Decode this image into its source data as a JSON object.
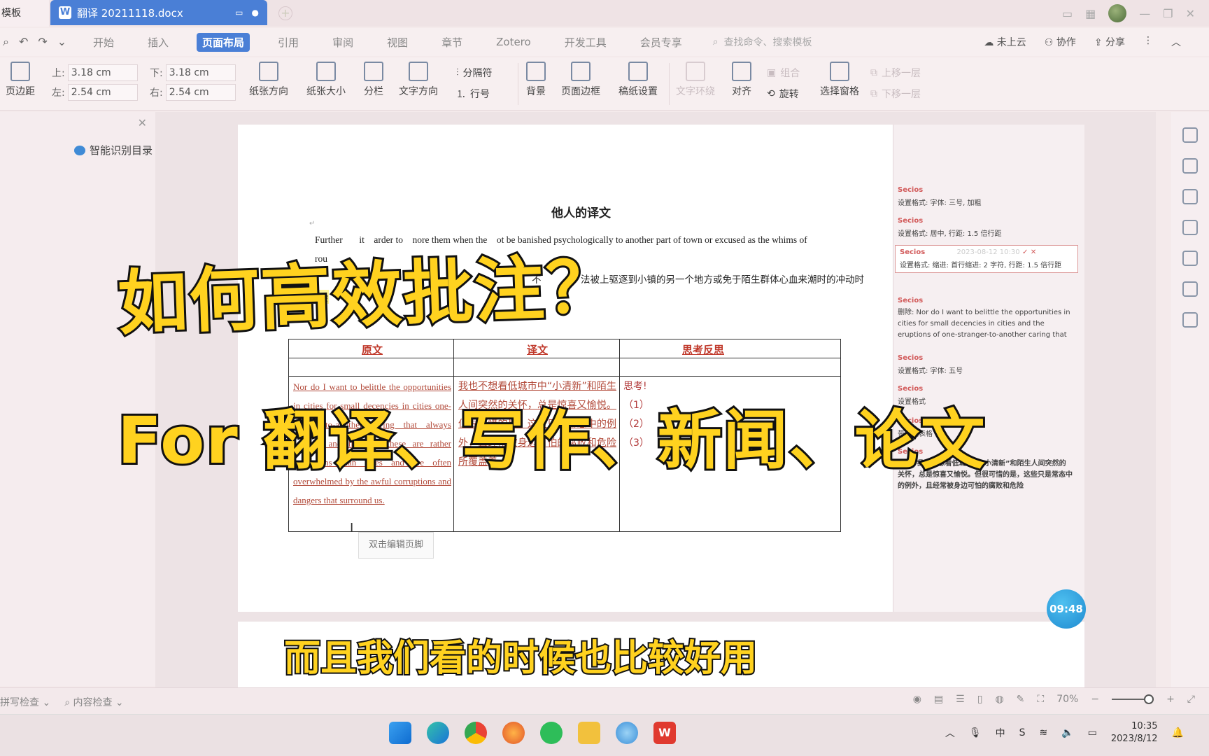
{
  "tabs": {
    "left_label": "模板",
    "active_doc": "翻译 20211118.docx"
  },
  "menu": {
    "items": [
      "开始",
      "插入",
      "页面布局",
      "引用",
      "审阅",
      "视图",
      "章节",
      "Zotero",
      "开发工具",
      "会员专享"
    ],
    "active": "页面布局",
    "search_placeholder": "查找命令、搜索模板",
    "cloud": "未上云",
    "collab": "协作",
    "share": "分享"
  },
  "ribbon": {
    "margins": "页边距",
    "top_label": "上:",
    "top_val": "3.18 cm",
    "bottom_label": "下:",
    "bottom_val": "3.18 cm",
    "left_label": "左:",
    "left_val": "2.54 cm",
    "right_label": "右:",
    "right_val": "2.54 cm",
    "orientation": "纸张方向",
    "size": "纸张大小",
    "columns": "分栏",
    "text_dir": "文字方向",
    "separator": "分隔符",
    "line_num": "行号",
    "background": "背景",
    "page_border": "页面边框",
    "manuscript": "稿纸设置",
    "wrap": "文字环绕",
    "align": "对齐",
    "rotate": "旋转",
    "select_pane": "选择窗格",
    "group": "组合",
    "up_layer": "上移一层",
    "down_layer": "下移一层"
  },
  "nav": {
    "toc": "智能识别目录"
  },
  "doc": {
    "title": "他人的译文",
    "para1a": "Further",
    "para1b": "it",
    "para1c": "arder to",
    "para1d": "nore them when the",
    "para1e": "ot be banished psychologically to another part of town or excused as the whims of",
    "para1f": "rou",
    "para1g": "ge",
    "para2a": "不",
    "para2b": "法被",
    "para2c": "上驱逐到小镇的另一个地方或免于陌生群体心血来潮时的冲动时",
    "para2d": "会",
    "table": {
      "headers": [
        "原文",
        "译文",
        "思考反思"
      ],
      "original": "Nor do I want to belittle the opportunities in cities for small decencies in cities one-stranger-to-another caring that always surprise and lift. But these are rather exceptions than rules and are often overwhelmed by the awful corruptions and dangers that surround us.",
      "translation": "我也不想看低城市中“小清新”和陌生人间突然的关怀，总是惊喜又愉悦。但很可惜的是，这些只是常态中的例外，且经常被身边可怕的腐败和危险所覆盖着。",
      "think_title": "思考!",
      "think_items": [
        "（1）",
        "（2）",
        "（3）"
      ]
    },
    "footer_btn": "双击编辑页脚"
  },
  "comments": [
    {
      "author": "Secios",
      "text": "设置格式: 字体: 三号, 加粗"
    },
    {
      "author": "Secios",
      "text": "设置格式: 居中, 行距: 1.5 倍行距"
    },
    {
      "author": "Secios",
      "text": "设置格式: 缩进: 首行缩进: 2 字符, 行距: 1.5 倍行距",
      "time": "2023-08-12 10:30"
    },
    {
      "author": "Secios",
      "text": "删除: Nor do I want to belittle the opportunities in cities for small decencies in cities and the eruptions of one-stranger-to-another caring that always surprise and"
    },
    {
      "author": "Secios",
      "text": "设置格式: 字体: 五号"
    },
    {
      "author": "Secios",
      "text": "设置格式"
    },
    {
      "author": "Secios",
      "text": "带格式表格"
    },
    {
      "author": "Secios",
      "text": "删除: 我也不想看低城市中“小清新”和陌生人间突然的关怀，总是惊喜又愉悦。但很可惜的是，这些只是常态中的例外，且经常被身边可怕的腐败和危险"
    }
  ],
  "overlay": {
    "line1": "如何高效批注？",
    "line2": "For 翻译、写作、新闻、论文",
    "subtitle": "而且我们看的时候也比较好用"
  },
  "timer": "09:48",
  "status": {
    "spell": "拼写检查",
    "content": "内容检查",
    "zoom": "70%"
  },
  "taskbar": {
    "time": "10:35",
    "date": "2023/8/12",
    "ime": "中"
  },
  "colors": {
    "accent": "#4a7fd6",
    "overlay": "#ffd21f",
    "comment_author": "#d25b5b"
  }
}
